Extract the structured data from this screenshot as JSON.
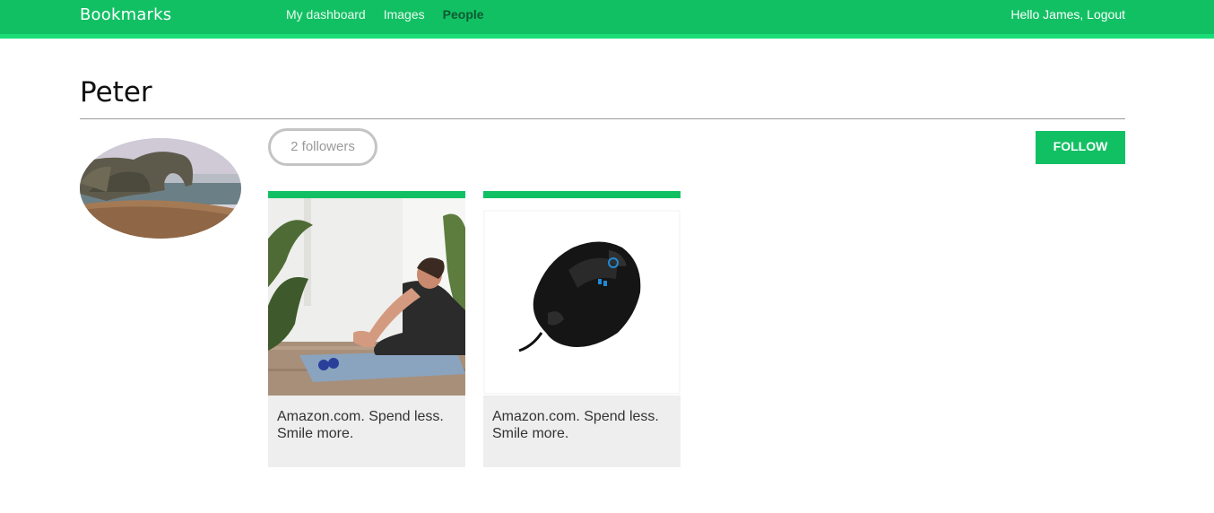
{
  "header": {
    "logo": "Bookmarks",
    "menu": [
      {
        "label": "My dashboard",
        "selected": false
      },
      {
        "label": "Images",
        "selected": false
      },
      {
        "label": "People",
        "selected": true
      }
    ],
    "greeting": "Hello James,",
    "logout": "Logout"
  },
  "profile": {
    "name": "Peter",
    "followers": "2 followers",
    "follow_label": "Follow"
  },
  "images": [
    {
      "caption": "Amazon.com. Spend less. Smile more.",
      "depicts": "woman stretching on yoga mat"
    },
    {
      "caption": "Amazon.com. Spend less. Smile more.",
      "depicts": "black gaming mouse"
    }
  ],
  "colors": {
    "accent": "#12c064",
    "accent_light": "#1bdd77",
    "card_bg": "#eeeeee"
  }
}
